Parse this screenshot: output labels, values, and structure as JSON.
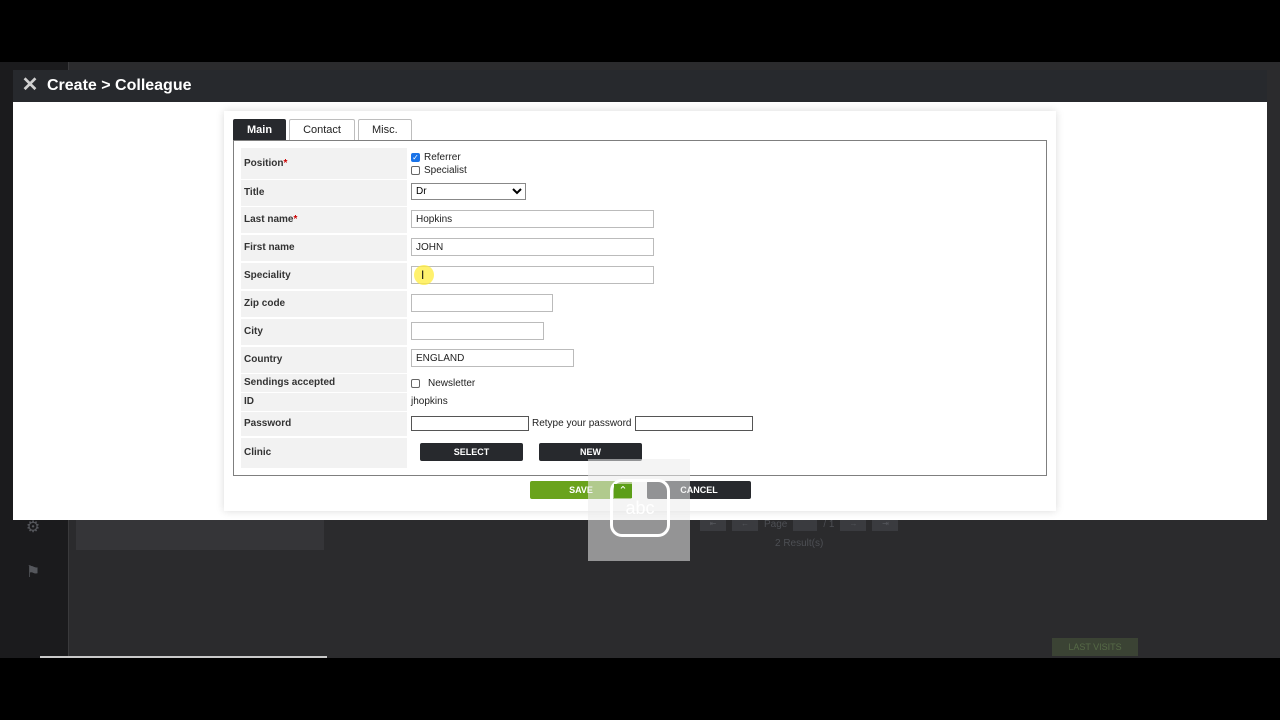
{
  "window": {
    "title": "Create > Colleague"
  },
  "tabs": [
    {
      "label": "Main",
      "active": true
    },
    {
      "label": "Contact",
      "active": false
    },
    {
      "label": "Misc.",
      "active": false
    }
  ],
  "form": {
    "position": {
      "label": "Position",
      "required_mark": "*",
      "options": [
        {
          "label": "Referrer",
          "checked": true
        },
        {
          "label": "Specialist",
          "checked": false
        }
      ]
    },
    "title": {
      "label": "Title",
      "value": "Dr"
    },
    "last_name": {
      "label": "Last name",
      "required_mark": "*",
      "value": "Hopkins"
    },
    "first_name": {
      "label": "First name",
      "value": "JOHN"
    },
    "speciality": {
      "label": "Speciality",
      "value": ""
    },
    "zip_code": {
      "label": "Zip code",
      "value": ""
    },
    "city": {
      "label": "City",
      "value": ""
    },
    "country": {
      "label": "Country",
      "value": "ENGLAND"
    },
    "sendings": {
      "label": "Sendings accepted",
      "option": "Newsletter",
      "checked": false
    },
    "id": {
      "label": "ID",
      "value": "jhopkins"
    },
    "password": {
      "label": "Password",
      "retype_label": "Retype your password"
    },
    "clinic": {
      "label": "Clinic",
      "select_button": "SELECT",
      "new_button": "NEW"
    }
  },
  "actions": {
    "save": "SAVE",
    "cancel": "CANCEL"
  },
  "overlay": {
    "ime_label": "abc"
  },
  "background": {
    "pager_label": "Page",
    "pager_total": "/ 1",
    "results": "2 Result(s)",
    "last_visits": "LAST VISITS"
  },
  "colors": {
    "header": "#27292d",
    "save": "#6aa31c",
    "required": "#cc0000"
  }
}
